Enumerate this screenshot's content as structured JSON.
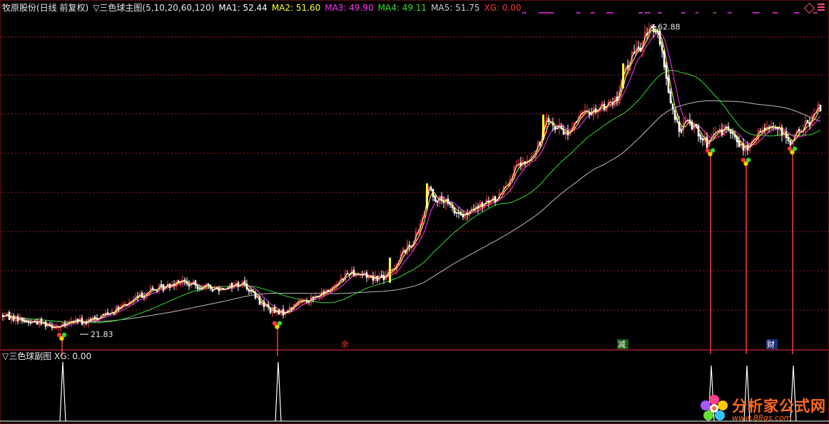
{
  "header": {
    "stock": "牧原股份(日线 前复权)",
    "indicator": "▽三色球主图(5,10,20,60,120)",
    "ma1_label": "MA1: 52.44",
    "ma2_label": "MA2: 51.60",
    "ma3_label": "MA3: 49.90",
    "ma4_label": "MA4: 49.11",
    "ma5_label": "MA5: 51.75",
    "xg_label": "XG: 0.00"
  },
  "sub_header": {
    "label": "▽三色球副图 XG: 0.00"
  },
  "icons": [
    "diamond-icon",
    "menu-icon",
    "flower-logo-icon"
  ],
  "logo": {
    "name": "分析家公式网",
    "url": "www.88gs.com"
  },
  "colors": {
    "background": "#000000",
    "grid": "#7a1a1a",
    "up": "#ff3b3b",
    "down": "#ffffff",
    "ma1": "#ffffff",
    "ma2": "#ffff33",
    "ma3": "#ff33ff",
    "ma4": "#33dd33",
    "ma5": "#bbbbbb",
    "xg": "#ff3333",
    "signal_line": "#ff4444"
  },
  "chart_data": [
    {
      "type": "candlestick",
      "title": "三色球主图",
      "period": "日线 前复权",
      "annotations": [
        {
          "text": "21.83",
          "kind": "low"
        },
        {
          "text": "62.88",
          "kind": "high"
        },
        {
          "text": "余",
          "kind": "event"
        },
        {
          "text": "减",
          "kind": "event"
        },
        {
          "text": "财",
          "kind": "event"
        }
      ],
      "price_path": [
        [
          0,
          23.5
        ],
        [
          12,
          23.2
        ],
        [
          25,
          23.0
        ],
        [
          38,
          22.5
        ],
        [
          50,
          22.6
        ],
        [
          64,
          22.3
        ],
        [
          76,
          22.0
        ],
        [
          84,
          21.83
        ],
        [
          95,
          22.3
        ],
        [
          106,
          22.8
        ],
        [
          118,
          22.4
        ],
        [
          132,
          23.0
        ],
        [
          150,
          23.8
        ],
        [
          170,
          24.5
        ],
        [
          190,
          25.8
        ],
        [
          210,
          26.8
        ],
        [
          230,
          27.2
        ],
        [
          250,
          28.3
        ],
        [
          262,
          27.6
        ],
        [
          280,
          27.4
        ],
        [
          300,
          27.0
        ],
        [
          320,
          27.4
        ],
        [
          340,
          27.8
        ],
        [
          350,
          26.8
        ],
        [
          362,
          25.4
        ],
        [
          378,
          24.2
        ],
        [
          390,
          23.6
        ],
        [
          404,
          24.2
        ],
        [
          420,
          25.4
        ],
        [
          440,
          25.8
        ],
        [
          460,
          26.8
        ],
        [
          475,
          28.2
        ],
        [
          490,
          29.4
        ],
        [
          505,
          29.0
        ],
        [
          520,
          28.6
        ],
        [
          540,
          28.6
        ],
        [
          555,
          30.5
        ],
        [
          565,
          32.2
        ],
        [
          575,
          33.0
        ],
        [
          590,
          35.8
        ],
        [
          600,
          40.8
        ],
        [
          610,
          39.2
        ],
        [
          622,
          38.8
        ],
        [
          635,
          37.6
        ],
        [
          650,
          36.8
        ],
        [
          665,
          37.8
        ],
        [
          680,
          38.6
        ],
        [
          695,
          39.2
        ],
        [
          710,
          41.6
        ],
        [
          725,
          43.6
        ],
        [
          740,
          44.2
        ],
        [
          755,
          46.4
        ],
        [
          765,
          50.8
        ],
        [
          775,
          48.8
        ],
        [
          785,
          48.6
        ],
        [
          795,
          48.0
        ],
        [
          805,
          49.8
        ],
        [
          820,
          50.8
        ],
        [
          835,
          51.4
        ],
        [
          850,
          52.0
        ],
        [
          865,
          52.6
        ],
        [
          875,
          56.8
        ],
        [
          885,
          58.6
        ],
        [
          900,
          60.2
        ],
        [
          910,
          62.88
        ],
        [
          920,
          61.6
        ],
        [
          930,
          57.4
        ],
        [
          940,
          51.6
        ],
        [
          950,
          48.6
        ],
        [
          962,
          49.6
        ],
        [
          975,
          48.8
        ],
        [
          990,
          46.6
        ],
        [
          1000,
          47.6
        ],
        [
          1015,
          48.8
        ],
        [
          1030,
          47.2
        ],
        [
          1045,
          45.8
        ],
        [
          1060,
          47.6
        ],
        [
          1075,
          49.4
        ],
        [
          1090,
          48.6
        ],
        [
          1105,
          46.8
        ],
        [
          1120,
          48.4
        ],
        [
          1135,
          49.8
        ],
        [
          1148,
          51.6
        ]
      ],
      "lines": [
        {
          "name": "MA1",
          "value": 52.44
        },
        {
          "name": "MA2",
          "value": 51.6
        },
        {
          "name": "MA3",
          "value": 49.9
        },
        {
          "name": "MA4",
          "value": 49.11
        },
        {
          "name": "MA5",
          "value": 51.75
        }
      ],
      "signals": [
        {
          "kind": "ball-cluster",
          "at": 86
        },
        {
          "kind": "ball-cluster",
          "at": 388
        },
        {
          "kind": "ball-cluster",
          "at": 995
        },
        {
          "kind": "ball-cluster",
          "at": 1045
        },
        {
          "kind": "ball-cluster",
          "at": 1110
        }
      ]
    },
    {
      "type": "line",
      "title": "三色球副图",
      "series": [
        {
          "name": "XG",
          "value": 0.0
        }
      ],
      "spikes": [
        88,
        390,
        997,
        1047,
        1112
      ]
    }
  ]
}
